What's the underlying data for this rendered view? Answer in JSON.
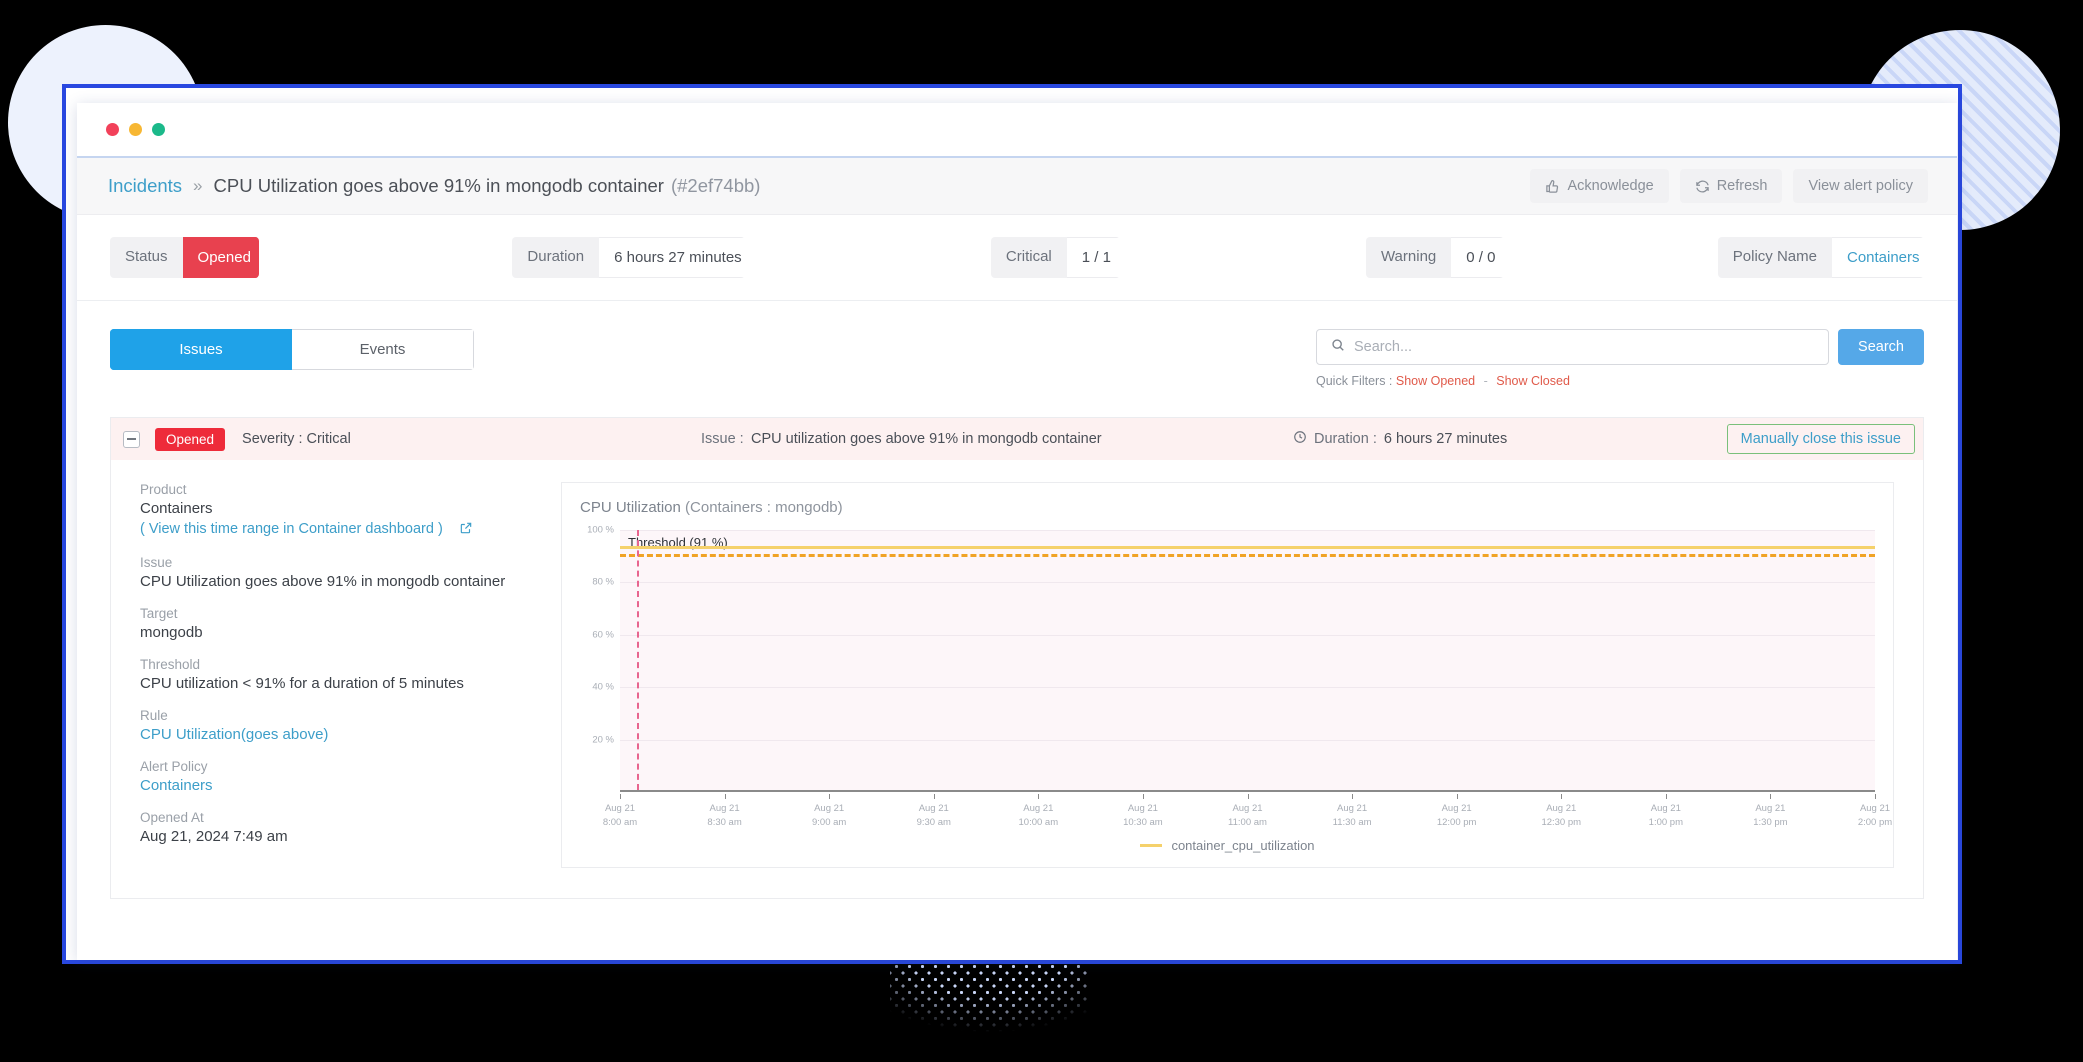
{
  "window": {
    "traffic_lights": [
      "red",
      "yellow",
      "green"
    ]
  },
  "breadcrumb": {
    "root": "Incidents",
    "separator": "»",
    "title": "CPU Utilization goes above 91% in mongodb container",
    "id": "(#2ef74bb)"
  },
  "header_actions": [
    {
      "label": "Acknowledge",
      "icon": "thumbs-up-icon"
    },
    {
      "label": "Refresh",
      "icon": "refresh-icon"
    },
    {
      "label": "View alert policy",
      "icon": "none"
    }
  ],
  "summary": [
    {
      "key": "Status",
      "value": "Opened",
      "style": "opened"
    },
    {
      "key": "Duration",
      "value": "6 hours 27 minutes",
      "style": "plain"
    },
    {
      "key": "Critical",
      "value": "1 / 1",
      "style": "critical"
    },
    {
      "key": "Warning",
      "value": "0 / 0",
      "style": "warning"
    },
    {
      "key": "Policy Name",
      "value": "Containers",
      "style": "link"
    }
  ],
  "tabs": [
    {
      "label": "Issues",
      "active": true
    },
    {
      "label": "Events",
      "active": false
    }
  ],
  "search": {
    "placeholder": "Search...",
    "value": "",
    "button_label": "Search",
    "icon": "search-icon"
  },
  "quick_filters": {
    "label": "Quick Filters :",
    "options": [
      "Show Opened",
      "Show Closed"
    ],
    "separator": "-"
  },
  "issue": {
    "status_badge": "Opened",
    "severity": "Severity : Critical",
    "issue_label": "Issue :",
    "issue_value": "CPU utilization goes above 91% in mongodb container",
    "duration_label": "Duration :",
    "duration_value": "6 hours 27 minutes",
    "duration_icon": "clock-icon",
    "close_button": "Manually close this issue"
  },
  "details": [
    {
      "label": "Product",
      "value": "Containers",
      "type": "text"
    },
    {
      "label": "",
      "value": "( View this time range in Container dashboard )",
      "type": "link-paren",
      "icon": "external-link-icon"
    },
    {
      "label": "Issue",
      "value": "CPU Utilization goes above 91% in mongodb container",
      "type": "text"
    },
    {
      "label": "Target",
      "value": "mongodb",
      "type": "text"
    },
    {
      "label": "Threshold",
      "value": "CPU utilization < 91% for a duration of 5 minutes",
      "type": "text"
    },
    {
      "label": "Rule",
      "value": "CPU Utilization(goes above)",
      "type": "link"
    },
    {
      "label": "Alert Policy",
      "value": "Containers",
      "type": "link"
    },
    {
      "label": "Opened At",
      "value": "Aug 21, 2024 7:49 am",
      "type": "text"
    }
  ],
  "chart_data": {
    "type": "line",
    "title": "CPU Utilization",
    "subtitle": "(Containers : mongodb)",
    "xlabel": "",
    "ylabel": "",
    "ylim": [
      0,
      100
    ],
    "yticks": [
      "100 %",
      "80 %",
      "60 %",
      "40 %",
      "20 %"
    ],
    "ytick_values": [
      100,
      80,
      60,
      40,
      20
    ],
    "grid": true,
    "legend_position": "bottom",
    "legend": [
      "container_cpu_utilization"
    ],
    "series_color": "#f5d16b",
    "threshold": {
      "label": "Threshold (91 %)",
      "value": 91,
      "color": "#f0a326",
      "style": "dashed"
    },
    "marker_line": {
      "label": "",
      "x_index": 0.22,
      "color": "#e8658f",
      "style": "dashed"
    },
    "x_date": "Aug 21",
    "categories": [
      "8:00 am",
      "8:30 am",
      "9:00 am",
      "9:30 am",
      "10:00 am",
      "10:30 am",
      "11:00 am",
      "11:30 am",
      "12:00 pm",
      "12:30 pm",
      "1:00 pm",
      "1:30 pm",
      "2:00 pm"
    ],
    "series": [
      {
        "name": "container_cpu_utilization",
        "values": [
          94,
          94,
          94,
          94,
          94,
          94,
          94,
          94,
          94,
          94,
          94,
          94,
          94
        ]
      }
    ]
  }
}
